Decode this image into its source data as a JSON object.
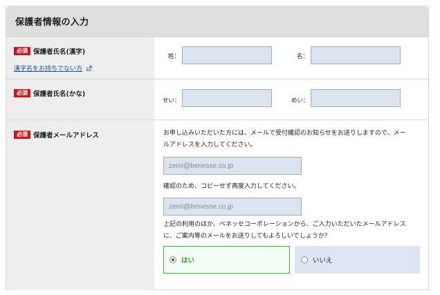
{
  "section": {
    "title": "保護者情報の入力"
  },
  "required_badge": "必須",
  "name_kanji": {
    "label": "保護者氏名(漢字)",
    "link": "漢字名をお持ちでない方",
    "last_label": "姓：",
    "first_label": "名：",
    "last_value": "",
    "first_value": ""
  },
  "name_kana": {
    "label": "保護者氏名(かな)",
    "last_label": "せい：",
    "first_label": "めい：",
    "last_value": "",
    "first_value": ""
  },
  "email": {
    "label": "保護者メールアドレス",
    "desc_line1": "お申し込みいただいた方には、メールで受付確認のお知らせをお送りしますので、メー",
    "desc_line2": "ルアドレスを入力してください。",
    "placeholder": "zemi@benesse.co.jp",
    "confirm_text": "確認のため、コピーせず再度入力してください。",
    "confirm_placeholder": "zemi@benesse.co.jp",
    "consent_line1": "上記の利用のほか、ベネッセコーポレーションから、ご入力いただいたメールアドレス",
    "consent_line2": "に、ご案内等のメールをお送りしてもよろしいでしょうか？",
    "options": [
      {
        "label": "はい",
        "selected": true
      },
      {
        "label": "いいえ",
        "selected": false
      }
    ]
  }
}
